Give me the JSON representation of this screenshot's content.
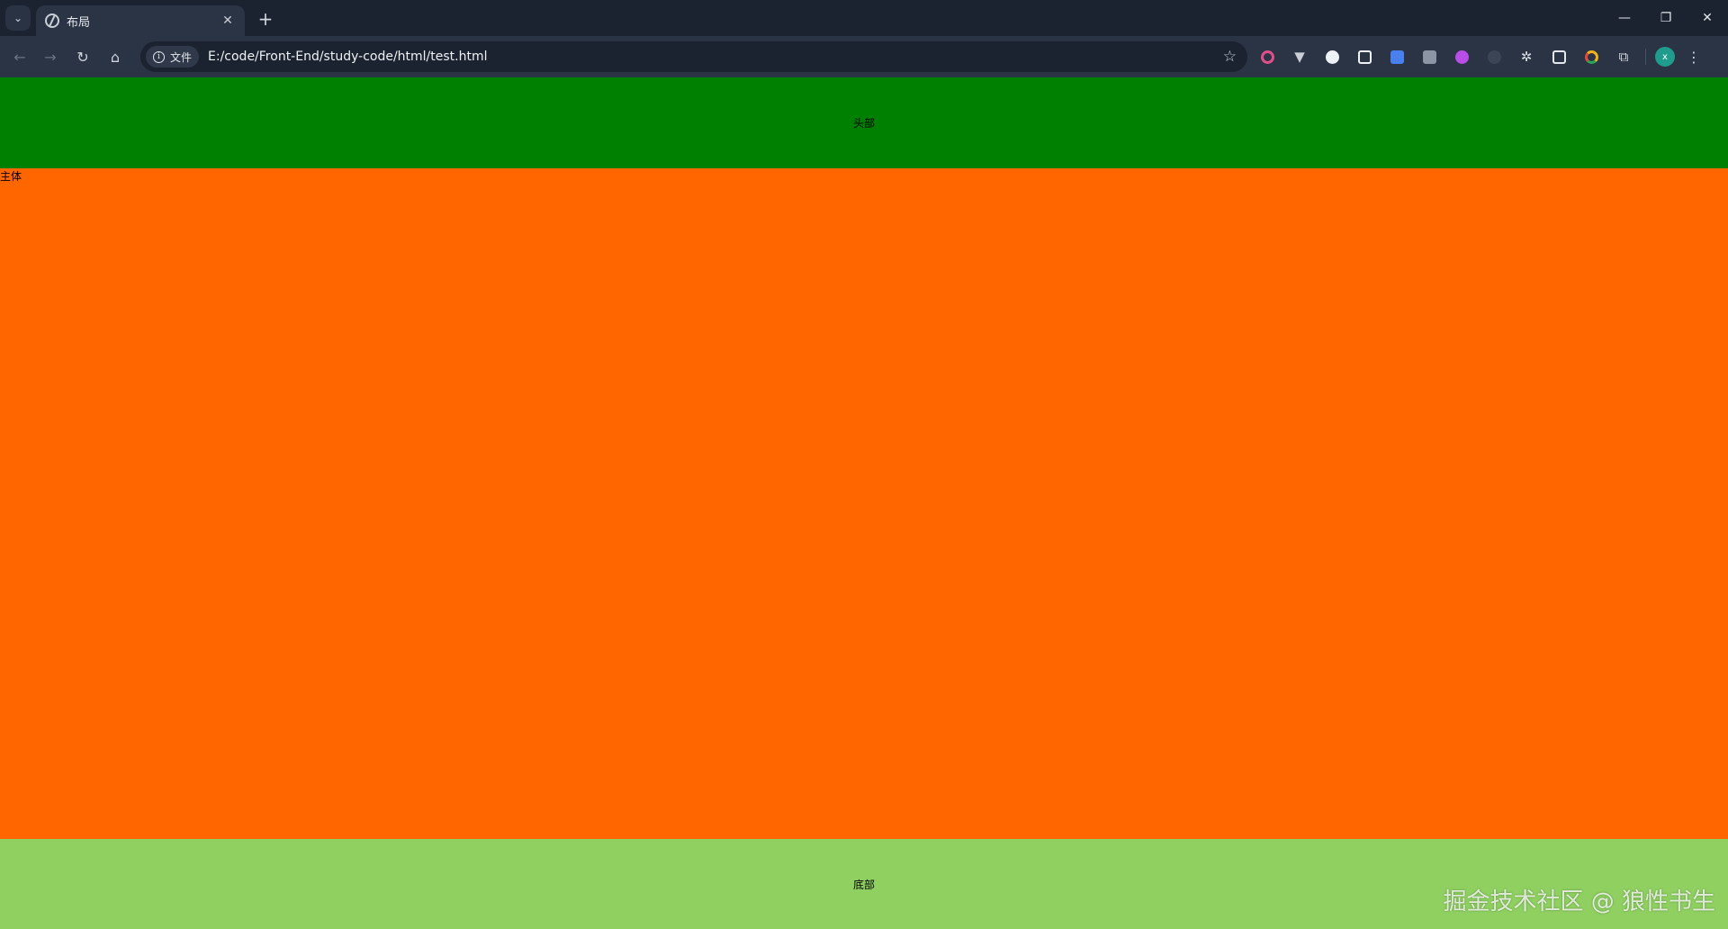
{
  "browser": {
    "tab": {
      "title": "布局",
      "close_glyph": "✕"
    },
    "new_tab_glyph": "+",
    "tab_menu_glyph": "⌄",
    "window_controls": [
      "—",
      "❐",
      "✕"
    ],
    "toolbar": {
      "back_glyph": "←",
      "forward_glyph": "→",
      "reload_glyph": "↻",
      "home_glyph": "⌂",
      "site_chip_label": "文件",
      "url": "E:/code/Front-End/study-code/html/test.html",
      "bookmark_glyph": "☆"
    },
    "extensions": [
      {
        "icon": "ring-extension-icon",
        "color": "#e04f8a"
      },
      {
        "icon": "vue-devtools-icon",
        "color": "#c9ced6"
      },
      {
        "icon": "circle-extension-icon",
        "color": "#eef1f5"
      },
      {
        "icon": "notion-icon",
        "color": "#eef1f5"
      },
      {
        "icon": "translate-icon",
        "color": "#4a7ff0"
      },
      {
        "icon": "gray-extension-icon",
        "color": "#8c95a3"
      },
      {
        "icon": "purple-extension-icon",
        "color": "#b84de8"
      },
      {
        "icon": "faint-extension-icon",
        "color": "#3b4556"
      },
      {
        "icon": "gear-extension-icon",
        "color": "#e3e6ec"
      },
      {
        "icon": "box-extension-icon",
        "color": "#e3e6ec"
      },
      {
        "icon": "chrome-color-icon",
        "color": "#f2b21c"
      },
      {
        "icon": "puzzle-icon",
        "color": "#d7dce4"
      }
    ],
    "avatar_letter": "x",
    "menu_glyph": "⋮"
  },
  "page": {
    "header_text": "头部",
    "main_text": "主体",
    "footer_text": "底部",
    "colors": {
      "header": "#008000",
      "main": "#ff6600",
      "footer": "#8fd061"
    }
  },
  "watermark": "掘金技术社区 @ 狼性书生"
}
